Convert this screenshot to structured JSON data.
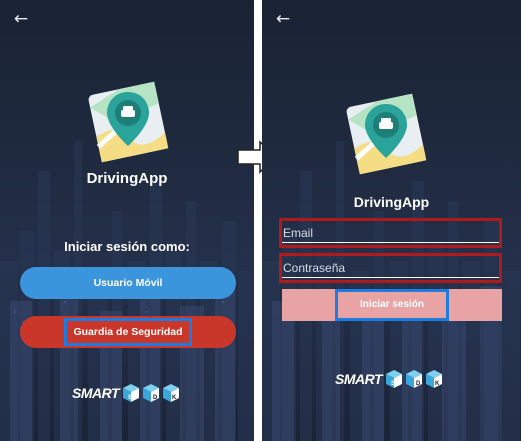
{
  "left_screen": {
    "app_name": "DrivingApp",
    "prompt": "Iniciar sesión como:",
    "buttons": {
      "mobile_user": "Usuario Móvil",
      "security_guard": "Guardia de Seguridad"
    },
    "brand_text": "SMART",
    "brand_letters": [
      "S",
      "D",
      "K"
    ]
  },
  "right_screen": {
    "app_name": "DrivingApp",
    "email_placeholder": "Email",
    "password_placeholder": "Contraseña",
    "login_button": "Iniciar sesión",
    "brand_text": "SMART",
    "brand_letters": [
      "S",
      "D",
      "K"
    ]
  },
  "icons": {
    "back": "arrow-left-icon",
    "transition": "arrow-right-icon",
    "app_logo": "map-pin-car-icon"
  },
  "colors": {
    "background": "#1f2a3f",
    "mobile_button": "#3b95dd",
    "security_button": "#c9372b",
    "login_button": "#e8a4a4",
    "highlight_blue": "#1e7be0",
    "highlight_red": "#b01a1a",
    "pin": "#2aa39a"
  }
}
